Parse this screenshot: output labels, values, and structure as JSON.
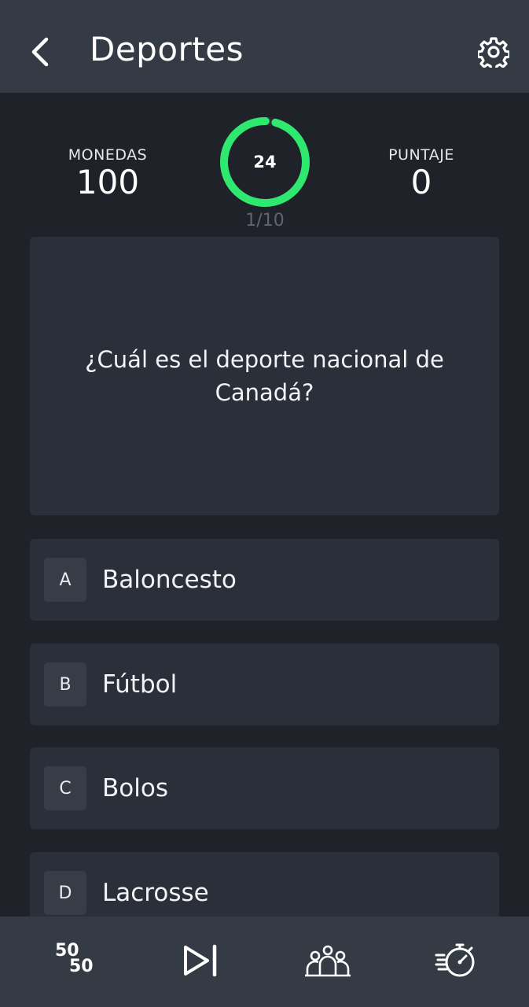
{
  "header": {
    "title": "Deportes",
    "back_icon": "chevron-left-icon",
    "settings_icon": "gear-icon"
  },
  "stats": {
    "coins_label": "MONEDAS",
    "coins_value": "100",
    "score_label": "PUNTAJE",
    "score_value": "0"
  },
  "timer": {
    "value": "24",
    "remaining_fraction": 0.96,
    "color": "#2ee86f"
  },
  "progress": "1/10",
  "question": "¿Cuál es el deporte nacional de Canadá?",
  "answers": [
    {
      "letter": "A",
      "text": "Baloncesto"
    },
    {
      "letter": "B",
      "text": "Fútbol"
    },
    {
      "letter": "C",
      "text": "Bolos"
    },
    {
      "letter": "D",
      "text": "Lacrosse"
    }
  ],
  "toolbar": {
    "fifty_top": "50",
    "fifty_bottom": "50",
    "items": [
      "fifty-fifty-icon",
      "skip-icon",
      "audience-icon",
      "time-freeze-icon"
    ]
  },
  "colors": {
    "background": "#1f2229",
    "header": "#353b45",
    "card": "#2b2f3a",
    "accent": "#2ee86f"
  }
}
